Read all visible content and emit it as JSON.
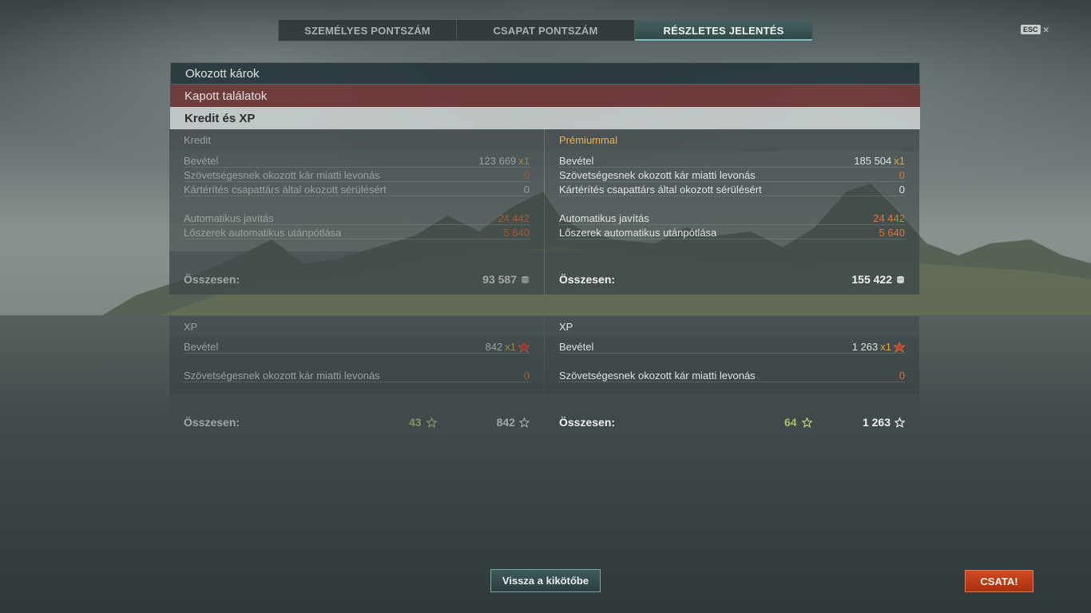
{
  "tabs": [
    {
      "label": "SZEMÉLYES PONTSZÁM",
      "active": false
    },
    {
      "label": "CSAPAT PONTSZÁM",
      "active": false
    },
    {
      "label": "RÉSZLETES JELENTÉS",
      "active": true
    }
  ],
  "esc": {
    "badge": "ESC",
    "close": "×"
  },
  "sections": {
    "damage": "Okozott károk",
    "hits": "Kapott találatok",
    "credit_xp": "Kredit és XP"
  },
  "credit_left": {
    "title": "Kredit",
    "income_label": "Bevétel",
    "income_value": "123 669",
    "income_mult": "x1",
    "ally_damage_label": "Szövetségesnek okozott kár miatti levonás",
    "ally_damage_value": "0",
    "compensation_label": "Kártérítés csapattárs által okozott sérülésért",
    "compensation_value": "0",
    "repair_label": "Automatikus javítás",
    "repair_value": "24 442",
    "ammo_label": "Lőszerek automatikus utánpótlása",
    "ammo_value": "5 640",
    "total_label": "Összesen:",
    "total_value": "93 587"
  },
  "credit_right": {
    "title": "Prémiummal",
    "income_label": "Bevétel",
    "income_value": "185 504",
    "income_mult": "x1",
    "ally_damage_label": "Szövetségesnek okozott kár miatti levonás",
    "ally_damage_value": "0",
    "compensation_label": "Kártérítés csapattárs által okozott sérülésért",
    "compensation_value": "0",
    "repair_label": "Automatikus javítás",
    "repair_value": "24 442",
    "ammo_label": "Lőszerek automatikus utánpótlása",
    "ammo_value": "5 640",
    "total_label": "Összesen:",
    "total_value": "155 422"
  },
  "xp_left": {
    "title": "XP",
    "income_label": "Bevétel",
    "income_value": "842",
    "income_mult": "x1",
    "ally_damage_label": "Szövetségesnek okozott kár miatti levonás",
    "ally_damage_value": "0",
    "total_label": "Összesen:",
    "free_xp": "43",
    "total_value": "842"
  },
  "xp_right": {
    "title": "XP",
    "income_label": "Bevétel",
    "income_value": "1 263",
    "income_mult": "x1",
    "ally_damage_label": "Szövetségesnek okozott kár miatti levonás",
    "ally_damage_value": "0",
    "total_label": "Összesen:",
    "free_xp": "64",
    "total_value": "1 263"
  },
  "buttons": {
    "back_to_port": "Vissza a kikötőbe",
    "battle": "CSATA!"
  },
  "colors": {
    "deduction": "#e8722c",
    "multiplier": "#e0a838",
    "premium": "#e7b54f",
    "free_xp": "#a8c070",
    "battle_button": "#c13c18"
  }
}
